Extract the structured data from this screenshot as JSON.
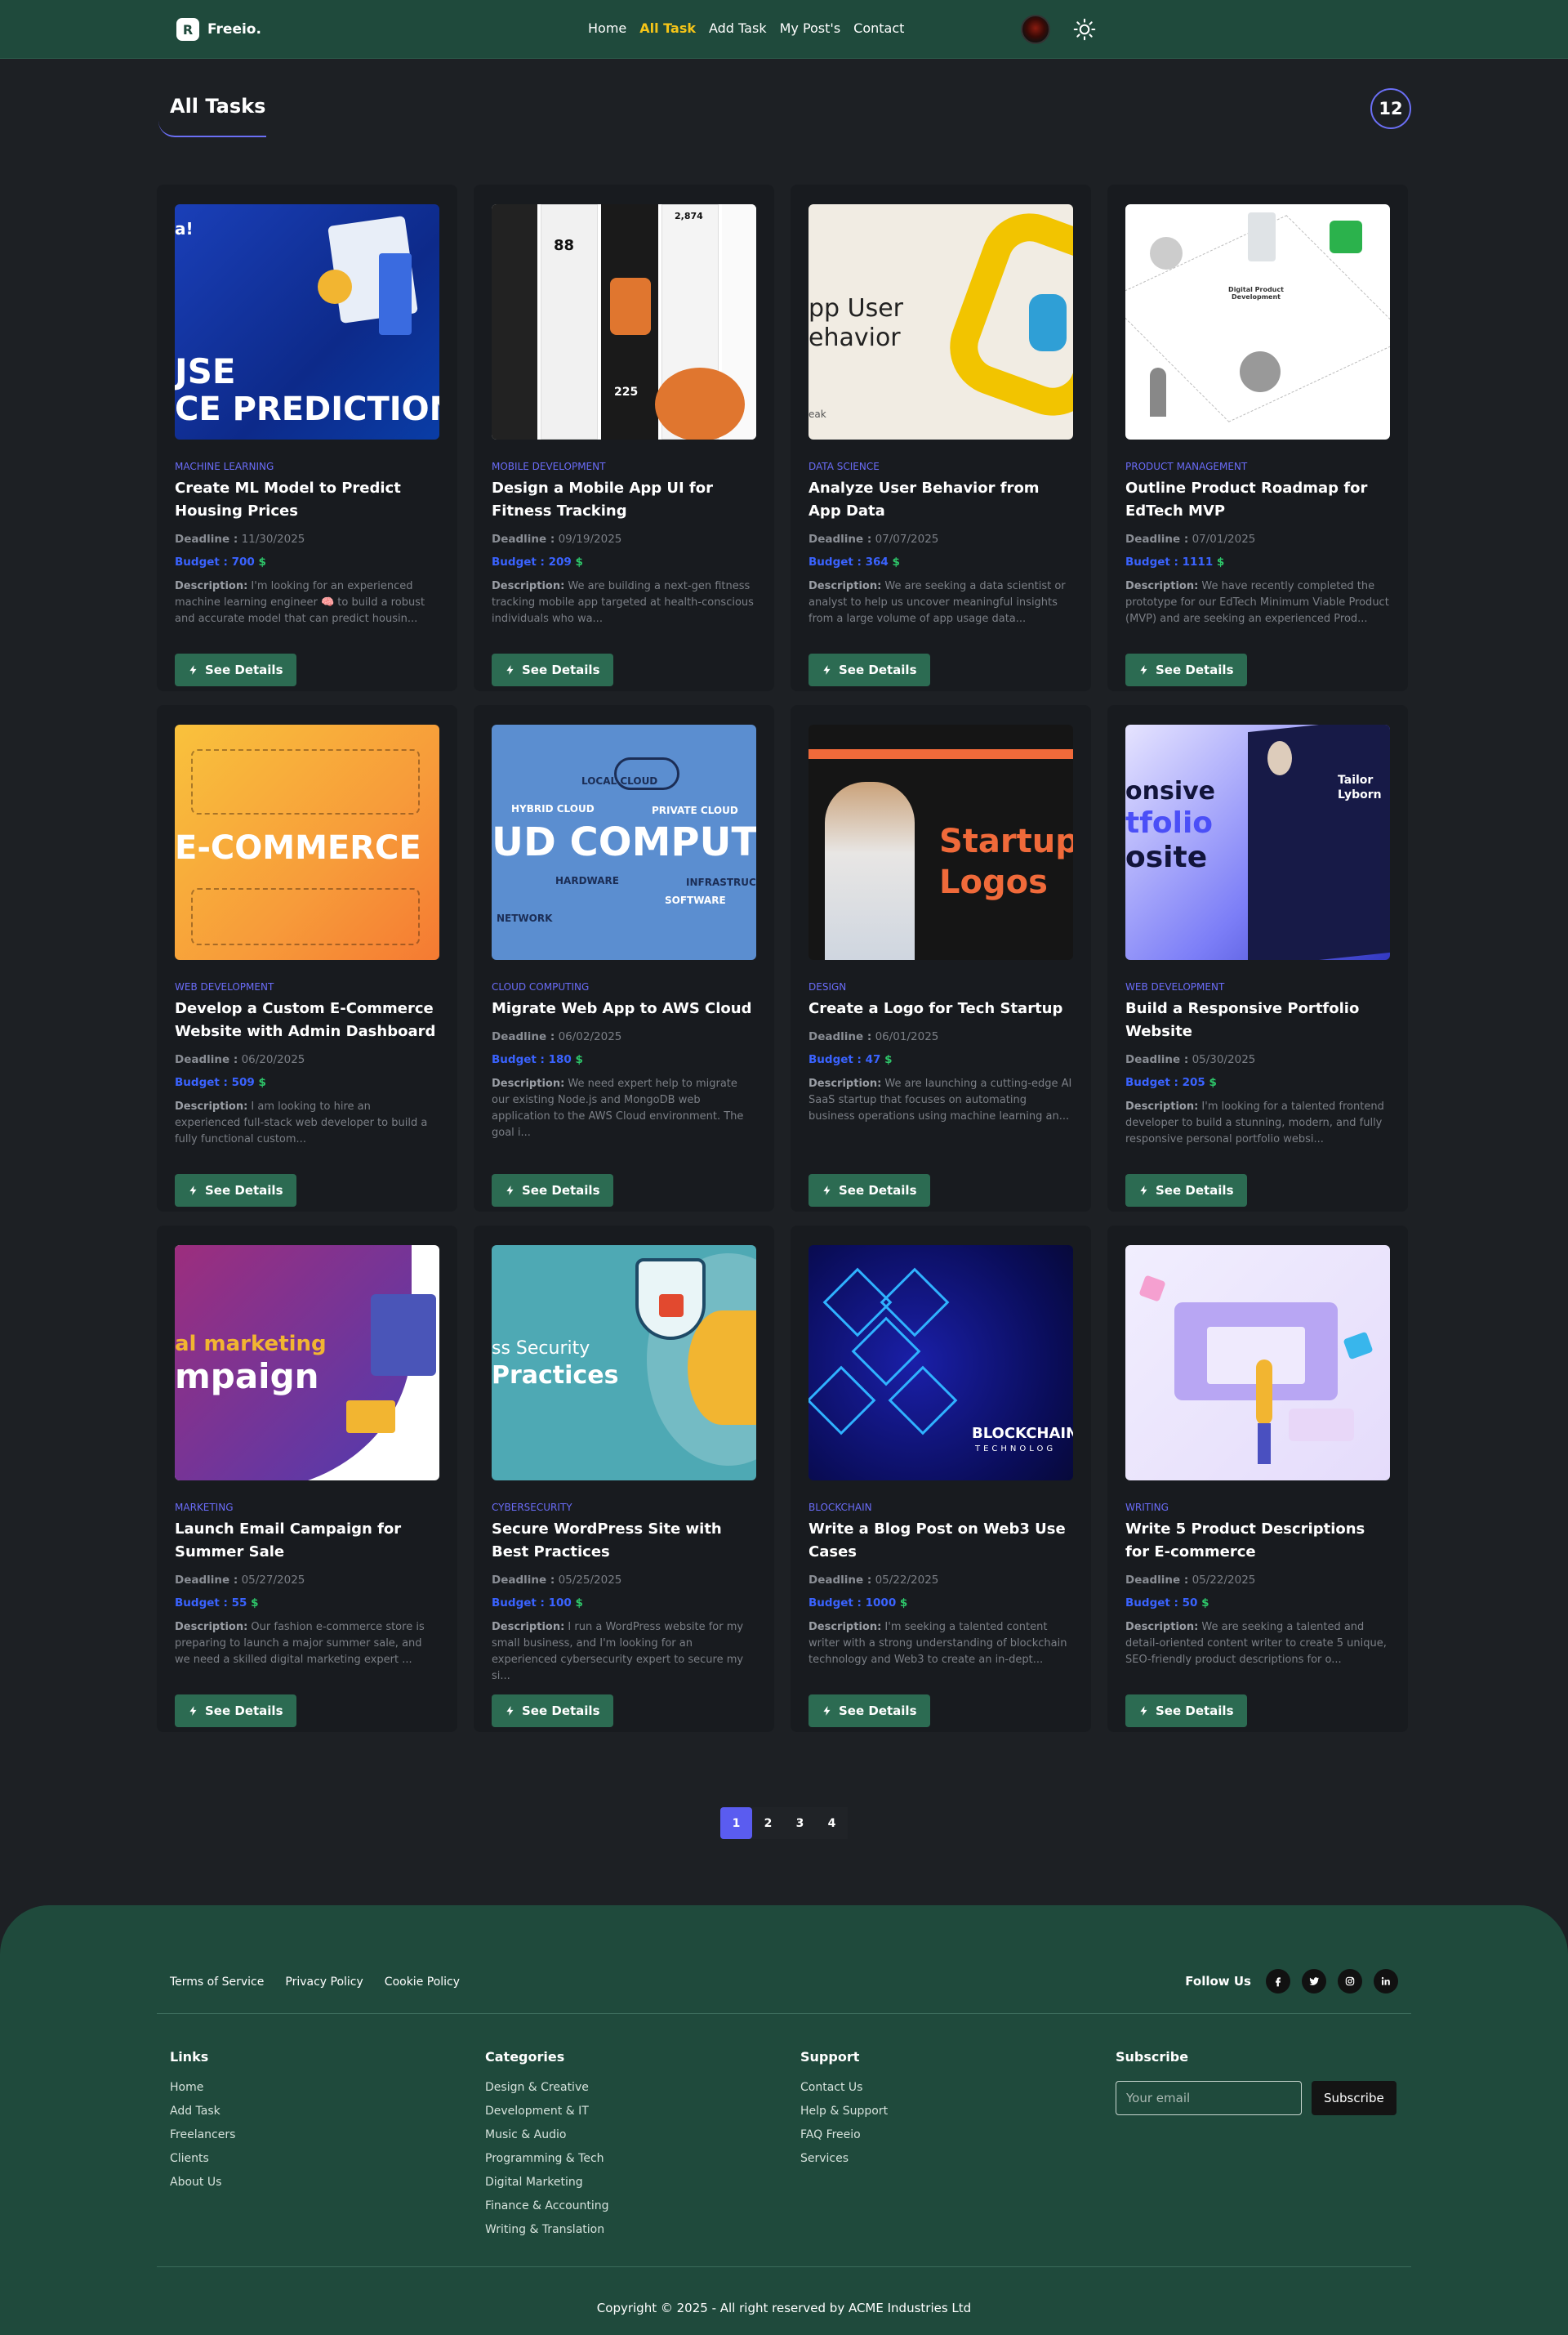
{
  "navbar": {
    "logo_letter": "R",
    "brand": "Freeio.",
    "links": [
      "Home",
      "All Task",
      "Add Task",
      "My Post's",
      "Contact"
    ],
    "active_link": "All Task"
  },
  "header": {
    "title": "All Tasks",
    "count": "12"
  },
  "labels": {
    "deadline": "Deadline :",
    "budget": "Budget :",
    "dollar": "$",
    "description": "Description:",
    "see_details": "See Details"
  },
  "tasks": [
    {
      "image_icon": "housing-prediction-image",
      "image_text": [
        "a!",
        "JSE",
        "CE PREDICTION"
      ],
      "category": "MACHINE LEARNING",
      "title": "Create ML Model to Predict Housing Prices",
      "deadline": "11/30/2025",
      "budget": "700",
      "description": "I'm looking for an experienced machine learning engineer 🧠 to build a robust and accurate model that can predict housin..."
    },
    {
      "image_icon": "fitness-app-screens-image",
      "image_text": [
        "88",
        "2,874",
        "225"
      ],
      "category": "MOBILE DEVELOPMENT",
      "title": "Design a Mobile App UI for Fitness Tracking",
      "deadline": "09/19/2025",
      "budget": "209",
      "description": "We are building a next-gen fitness tracking mobile app targeted at health-conscious individuals who wa..."
    },
    {
      "image_icon": "user-behavior-image",
      "image_text": [
        "pp User",
        "ehavior",
        "eak"
      ],
      "category": "DATA SCIENCE",
      "title": "Analyze User Behavior from App Data",
      "deadline": "07/07/2025",
      "budget": "364",
      "description": "We are seeking a data scientist or analyst to help us uncover meaningful insights from a large volume of app usage data..."
    },
    {
      "image_icon": "product-roadmap-image",
      "image_text": [
        "Digital Product Development"
      ],
      "category": "PRODUCT MANAGEMENT",
      "title": "Outline Product Roadmap for EdTech MVP",
      "deadline": "07/01/2025",
      "budget": "1111",
      "description": "We have recently completed the prototype for our EdTech Minimum Viable Product (MVP) and are seeking an experienced Prod..."
    },
    {
      "image_icon": "ecommerce-icons-image",
      "image_text": [
        "E-COMMERCE"
      ],
      "category": "WEB DEVELOPMENT",
      "title": "Develop a Custom E-Commerce Website with Admin Dashboard",
      "deadline": "06/20/2025",
      "budget": "509",
      "description": "I am looking to hire an experienced full-stack web developer to build a fully functional custom..."
    },
    {
      "image_icon": "cloud-computing-image",
      "image_text": [
        "LOCAL CLOUD",
        "HYBRID CLOUD",
        "PRIVATE CLOUD",
        "UD COMPUT",
        "HARDWARE",
        "INFRASTRUC",
        "SOFTWARE",
        "NETWORK"
      ],
      "category": "CLOUD COMPUTING",
      "title": "Migrate Web App to AWS Cloud",
      "deadline": "06/02/2025",
      "budget": "180",
      "description": "We need expert help to migrate our existing Node.js and MongoDB web application to the AWS Cloud environment. The goal i..."
    },
    {
      "image_icon": "startup-logos-image",
      "image_text": [
        "Startup",
        "Logos"
      ],
      "category": "DESIGN",
      "title": "Create a Logo for Tech Startup",
      "deadline": "06/01/2025",
      "budget": "47",
      "description": "We are launching a cutting-edge AI SaaS startup that focuses on automating business operations using machine learning an..."
    },
    {
      "image_icon": "portfolio-website-image",
      "image_text": [
        "onsive",
        "tfolio",
        "osite",
        "Tailor",
        "Lyborn"
      ],
      "category": "WEB DEVELOPMENT",
      "title": "Build a Responsive Portfolio Website",
      "deadline": "05/30/2025",
      "budget": "205",
      "description": "I'm looking for a talented frontend developer to build a stunning, modern, and fully responsive personal portfolio websi..."
    },
    {
      "image_icon": "digital-marketing-image",
      "image_text": [
        "al marketing",
        "mpaign"
      ],
      "category": "MARKETING",
      "title": "Launch Email Campaign for Summer Sale",
      "deadline": "05/27/2025",
      "budget": "55",
      "description": "Our fashion e-commerce store is preparing to launch a major summer sale, and we need a skilled digital marketing expert ..."
    },
    {
      "image_icon": "wordpress-security-image",
      "image_text": [
        "ss Security",
        "Practices"
      ],
      "category": "CYBERSECURITY",
      "title": "Secure WordPress Site with Best Practices",
      "deadline": "05/25/2025",
      "budget": "100",
      "description": "I run a WordPress website for my small business, and I'm looking for an experienced cybersecurity expert to secure my si..."
    },
    {
      "image_icon": "blockchain-image",
      "image_text": [
        "BLOCKCHAIN",
        "TECHNOLOG"
      ],
      "category": "BLOCKCHAIN",
      "title": "Write a Blog Post on Web3 Use Cases",
      "deadline": "05/22/2025",
      "budget": "1000",
      "description": "I'm seeking a talented content writer with a strong understanding of blockchain technology and Web3 to create an in-dept..."
    },
    {
      "image_icon": "writing-illustration-image",
      "image_text": [],
      "category": "WRITING",
      "title": "Write 5 Product Descriptions for E-commerce",
      "deadline": "05/22/2025",
      "budget": "50",
      "description": "We are seeking a talented and detail-oriented content writer to create 5 unique, SEO-friendly product descriptions for o..."
    }
  ],
  "pagination": {
    "pages": [
      "1",
      "2",
      "3",
      "4"
    ],
    "current": "1"
  },
  "footer": {
    "legal_links": [
      "Terms of Service",
      "Privacy Policy",
      "Cookie Policy"
    ],
    "follow_label": "Follow Us",
    "socials": [
      "facebook-icon",
      "twitter-icon",
      "instagram-icon",
      "linkedin-icon"
    ],
    "columns": [
      {
        "title": "Links",
        "items": [
          "Home",
          "Add Task",
          "Freelancers",
          "Clients",
          "About Us"
        ]
      },
      {
        "title": "Categories",
        "items": [
          "Design & Creative",
          "Development & IT",
          "Music & Audio",
          "Programming & Tech",
          "Digital Marketing",
          "Finance & Accounting",
          "Writing & Translation"
        ]
      },
      {
        "title": "Support",
        "items": [
          "Contact Us",
          "Help & Support",
          "FAQ Freeio",
          "Services"
        ]
      }
    ],
    "subscribe": {
      "title": "Subscribe",
      "placeholder": "Your email",
      "button": "Subscribe"
    },
    "copyright": "Copyright © 2025 - All right reserved by ACME Industries Ltd"
  },
  "colors": {
    "navbar": "#1f4a3c",
    "background": "#1d2024",
    "card": "#181b1f",
    "accent_purple": "#6b6ff5",
    "active_link": "#f5c518",
    "budget_blue": "#3a63ff",
    "dollar_green": "#2ec76a",
    "button_green": "#2c6b52"
  }
}
